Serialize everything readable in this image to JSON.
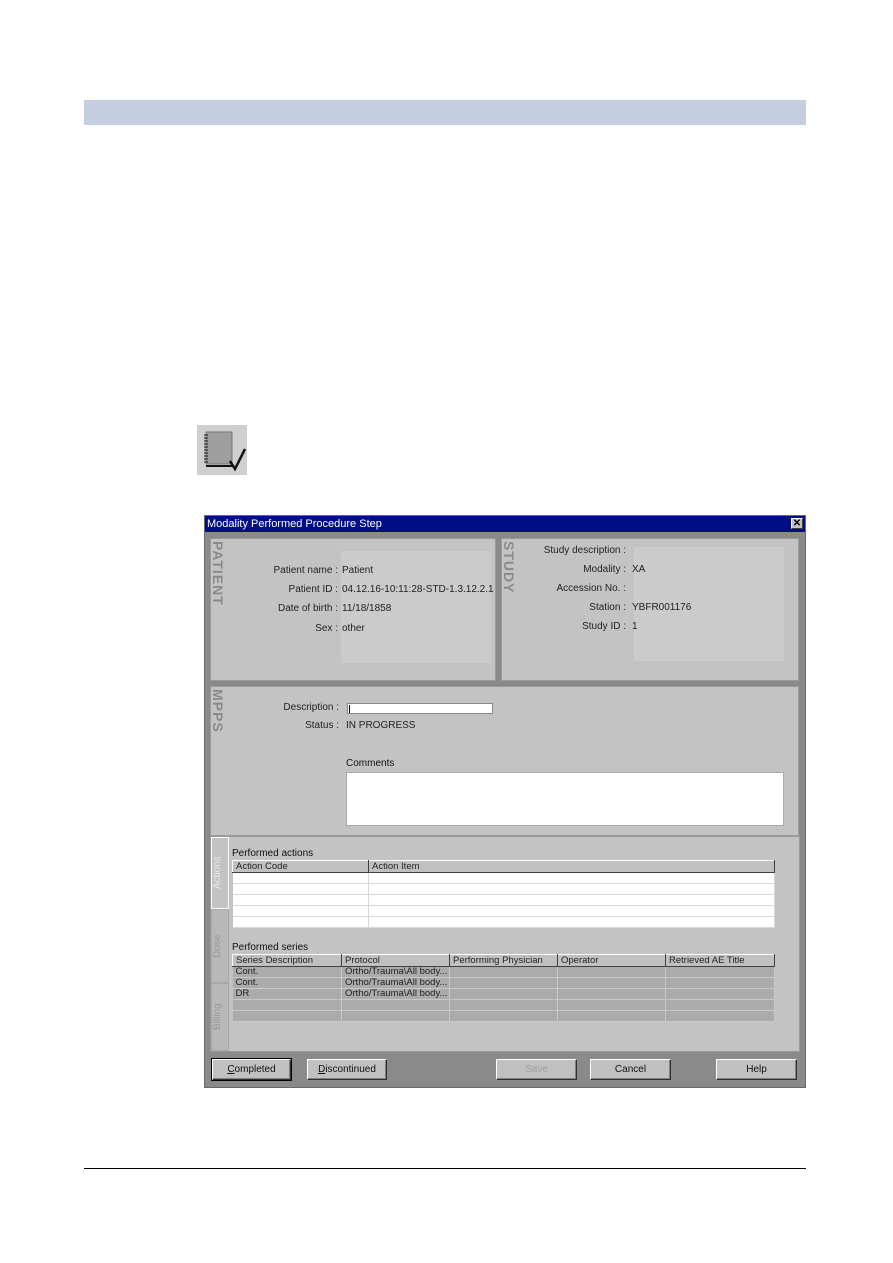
{
  "page": {
    "icon": "notebook-check-icon"
  },
  "dialog": {
    "title": "Modality Performed Procedure Step",
    "close_icon": "close-icon",
    "patient": {
      "section_label": "PATIENT",
      "fields": [
        {
          "label": "Patient name :",
          "value": "Patient"
        },
        {
          "label": "Patient ID :",
          "value": "04.12.16-10:11:28-STD-1.3.12.2.1"
        },
        {
          "label": "Date of birth :",
          "value": "11/18/1858"
        },
        {
          "label": "Sex :",
          "value": "other"
        }
      ]
    },
    "study": {
      "section_label": "STUDY",
      "fields": [
        {
          "label": "Study description :",
          "value": ""
        },
        {
          "label": "Modality :",
          "value": "XA"
        },
        {
          "label": "Accession No. :",
          "value": ""
        },
        {
          "label": "Station :",
          "value": "YBFR001176"
        },
        {
          "label": "Study ID :",
          "value": "1"
        }
      ]
    },
    "mpps": {
      "section_label": "MPPS",
      "description_label": "Description :",
      "description_value": "",
      "status_label": "Status :",
      "status_value": "IN PROGRESS",
      "comments_label": "Comments",
      "comments_value": ""
    },
    "tabs": [
      {
        "label": "Actions",
        "active": true
      },
      {
        "label": "Dose",
        "active": false
      },
      {
        "label": "Billing",
        "active": false
      }
    ],
    "performed_actions": {
      "title": "Performed actions",
      "columns": [
        "Action Code",
        "Action Item"
      ],
      "rows": [
        [
          "",
          ""
        ],
        [
          "",
          ""
        ],
        [
          "",
          ""
        ],
        [
          "",
          ""
        ],
        [
          "",
          ""
        ]
      ]
    },
    "performed_series": {
      "title": "Performed series",
      "columns": [
        "Series Description",
        "Protocol",
        "Performing Physician",
        "Operator",
        "Retrieved AE Title"
      ],
      "rows": [
        [
          "Cont.",
          "Ortho/Trauma\\All body...",
          "",
          "",
          ""
        ],
        [
          "Cont.",
          "Ortho/Trauma\\All body...",
          "",
          "",
          ""
        ],
        [
          "DR",
          "Ortho/Trauma\\All body...",
          "",
          "",
          ""
        ],
        [
          "",
          "",
          "",
          "",
          ""
        ],
        [
          "",
          "",
          "",
          "",
          ""
        ]
      ]
    },
    "buttons": {
      "completed": {
        "prefix": "",
        "accel": "C",
        "rest": "ompleted"
      },
      "discontinued": {
        "prefix": "",
        "accel": "D",
        "rest": "iscontinued"
      },
      "save": "Save",
      "cancel": "Cancel",
      "help": "Help"
    }
  }
}
